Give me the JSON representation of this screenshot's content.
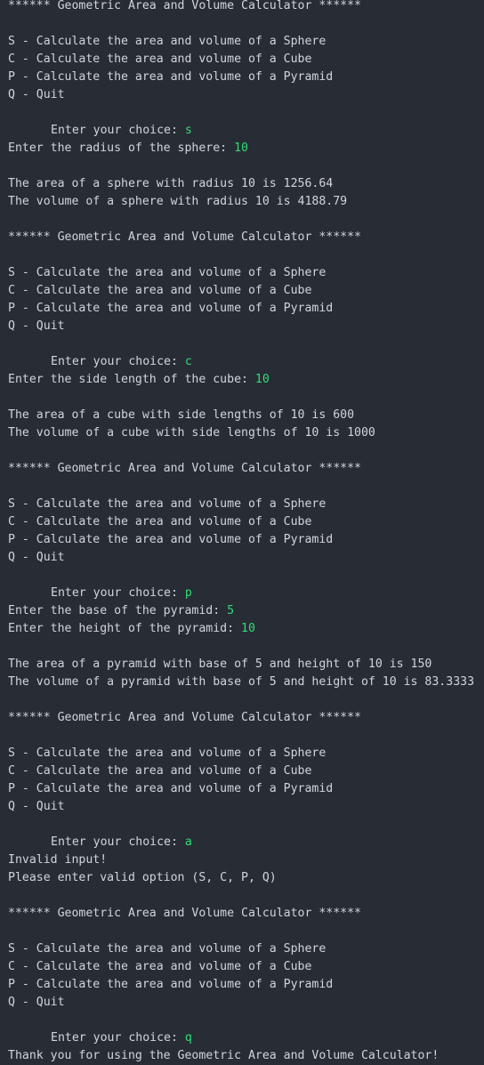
{
  "colors": {
    "background": "#282c34",
    "text": "#d1d5db",
    "user_input": "#2fde76"
  },
  "lines": [
    {
      "text": "****** Geometric Area and Volume Calculator ******"
    },
    {
      "text": ""
    },
    {
      "text": "S - Calculate the area and volume of a Sphere"
    },
    {
      "text": "C - Calculate the area and volume of a Cube"
    },
    {
      "text": "P - Calculate the area and volume of a Pyramid"
    },
    {
      "text": "Q - Quit"
    },
    {
      "text": ""
    },
    {
      "text": "Enter your choice: ",
      "input": "s",
      "indent": true
    },
    {
      "text": "Enter the radius of the sphere: ",
      "input": "10"
    },
    {
      "text": ""
    },
    {
      "text": "The area of a sphere with radius 10 is 1256.64"
    },
    {
      "text": "The volume of a sphere with radius 10 is 4188.79"
    },
    {
      "text": ""
    },
    {
      "text": "****** Geometric Area and Volume Calculator ******"
    },
    {
      "text": ""
    },
    {
      "text": "S - Calculate the area and volume of a Sphere"
    },
    {
      "text": "C - Calculate the area and volume of a Cube"
    },
    {
      "text": "P - Calculate the area and volume of a Pyramid"
    },
    {
      "text": "Q - Quit"
    },
    {
      "text": ""
    },
    {
      "text": "Enter your choice: ",
      "input": "c",
      "indent": true
    },
    {
      "text": "Enter the side length of the cube: ",
      "input": "10"
    },
    {
      "text": ""
    },
    {
      "text": "The area of a cube with side lengths of 10 is 600"
    },
    {
      "text": "The volume of a cube with side lengths of 10 is 1000"
    },
    {
      "text": ""
    },
    {
      "text": "****** Geometric Area and Volume Calculator ******"
    },
    {
      "text": ""
    },
    {
      "text": "S - Calculate the area and volume of a Sphere"
    },
    {
      "text": "C - Calculate the area and volume of a Cube"
    },
    {
      "text": "P - Calculate the area and volume of a Pyramid"
    },
    {
      "text": "Q - Quit"
    },
    {
      "text": ""
    },
    {
      "text": "Enter your choice: ",
      "input": "p",
      "indent": true
    },
    {
      "text": "Enter the base of the pyramid: ",
      "input": "5"
    },
    {
      "text": "Enter the height of the pyramid: ",
      "input": "10"
    },
    {
      "text": ""
    },
    {
      "text": "The area of a pyramid with base of 5 and height of 10 is 150"
    },
    {
      "text": "The volume of a pyramid with base of 5 and height of 10 is 83.3333"
    },
    {
      "text": ""
    },
    {
      "text": "****** Geometric Area and Volume Calculator ******"
    },
    {
      "text": ""
    },
    {
      "text": "S - Calculate the area and volume of a Sphere"
    },
    {
      "text": "C - Calculate the area and volume of a Cube"
    },
    {
      "text": "P - Calculate the area and volume of a Pyramid"
    },
    {
      "text": "Q - Quit"
    },
    {
      "text": ""
    },
    {
      "text": "Enter your choice: ",
      "input": "a",
      "indent": true
    },
    {
      "text": "Invalid input!"
    },
    {
      "text": "Please enter valid option (S, C, P, Q)"
    },
    {
      "text": ""
    },
    {
      "text": "****** Geometric Area and Volume Calculator ******"
    },
    {
      "text": ""
    },
    {
      "text": "S - Calculate the area and volume of a Sphere"
    },
    {
      "text": "C - Calculate the area and volume of a Cube"
    },
    {
      "text": "P - Calculate the area and volume of a Pyramid"
    },
    {
      "text": "Q - Quit"
    },
    {
      "text": ""
    },
    {
      "text": "Enter your choice: ",
      "input": "q",
      "indent": true
    },
    {
      "text": "Thank you for using the Geometric Area and Volume Calculator!"
    }
  ]
}
